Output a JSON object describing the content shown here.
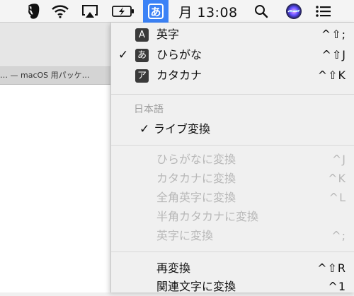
{
  "menubar": {
    "clock": "月 13:08",
    "ime_glyph": "あ",
    "icons": [
      "evernote-icon",
      "wifi-icon",
      "airplay-icon",
      "battery-charging-icon",
      "input-method-icon",
      "spotlight-icon",
      "siri-icon",
      "notification-center-icon"
    ],
    "accent": "#3b82f6"
  },
  "background_window": {
    "tab_title": "… — macOS 用パッケ…"
  },
  "menu": {
    "modes": [
      {
        "badge": "A",
        "label": "英字",
        "shortcut": "^⇧;",
        "checked": false
      },
      {
        "badge": "あ",
        "label": "ひらがな",
        "shortcut": "^⇧J",
        "checked": true
      },
      {
        "badge": "ア",
        "label": "カタカナ",
        "shortcut": "^⇧K",
        "checked": false
      }
    ],
    "check_glyph": "✓",
    "section_header": "日本語",
    "live_conversion": {
      "label": "ライブ変換",
      "checked": true
    },
    "convert_items": [
      {
        "label": "ひらがなに変換",
        "shortcut": "^J"
      },
      {
        "label": "カタカナに変換",
        "shortcut": "^K"
      },
      {
        "label": "全角英字に変換",
        "shortcut": "^L"
      },
      {
        "label": "半角カタカナに変換",
        "shortcut": ""
      },
      {
        "label": "英字に変換",
        "shortcut": "^;"
      }
    ],
    "bottom_items": [
      {
        "label": "再変換",
        "shortcut": "^⇧R"
      },
      {
        "label": "関連文字に変換",
        "shortcut": "^1"
      }
    ]
  }
}
